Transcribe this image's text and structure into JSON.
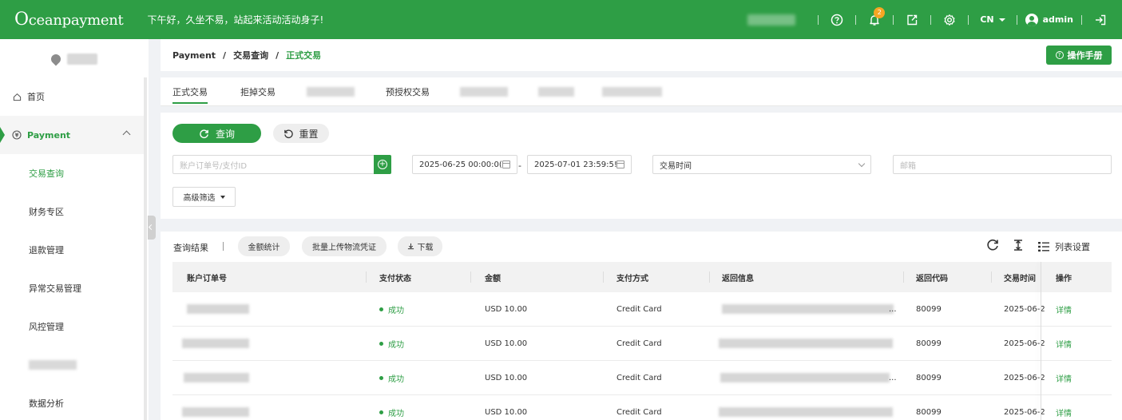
{
  "topbar": {
    "logo_first": "O",
    "logo_rest": "ceanpayment",
    "greeting": "下午好，久坐不易，站起来活动活动身子!",
    "notification_count": "2",
    "language": "CN",
    "username": "admin"
  },
  "sidebar": {
    "items": [
      {
        "label": "首页",
        "icon": "home-icon"
      },
      {
        "label": "Payment",
        "icon": "payment-icon"
      },
      {
        "label": "交易查询"
      },
      {
        "label": "财务专区"
      },
      {
        "label": "退款管理"
      },
      {
        "label": "异常交易管理"
      },
      {
        "label": "风控管理"
      },
      {
        "label": "数据分析"
      }
    ]
  },
  "breadcrumb": {
    "items": [
      "Payment",
      "交易查询",
      "正式交易"
    ],
    "separator": "/"
  },
  "header": {
    "manual_label": "操作手册"
  },
  "tabs": [
    "正式交易",
    "拒掉交易",
    "预授权交易"
  ],
  "filters": {
    "query_label": "查询",
    "reset_label": "重置",
    "order_placeholder": "账户订单号/支付ID",
    "start_date": "2025-06-25 00:00:0(",
    "end_date": "2025-07-01 23:59:5!",
    "date_separator": "-",
    "time_type": "交易时间",
    "email_placeholder": "邮箱",
    "advanced_label": "高级筛选"
  },
  "results": {
    "title": "查询结果",
    "separator": "|",
    "amount_stats_label": "金额统计",
    "batch_upload_label": "批量上传物流凭证",
    "download_label": "下载",
    "list_settings_label": "列表设置",
    "columns": [
      "账户订单号",
      "支付状态",
      "金额",
      "支付方式",
      "返回信息",
      "返回代码",
      "交易时间",
      "操作"
    ],
    "rows": [
      {
        "status": "成功",
        "amount": "USD 10.00",
        "method": "Credit Card",
        "info": "...",
        "code": "80099",
        "time": "2025-06-2",
        "action": "详情"
      },
      {
        "status": "成功",
        "amount": "USD 10.00",
        "method": "Credit Card",
        "info": "",
        "code": "80099",
        "time": "2025-06-2",
        "action": "详情"
      },
      {
        "status": "成功",
        "amount": "USD 10.00",
        "method": "Credit Card",
        "info": "...",
        "code": "80099",
        "time": "2025-06-2",
        "action": "详情"
      },
      {
        "status": "成功",
        "amount": "USD 10.00",
        "method": "Credit Card",
        "info": "",
        "code": "80099",
        "time": "2025-06-2",
        "action": "详情"
      }
    ]
  },
  "colors": {
    "brand": "#2e9e45",
    "badge": "#f5a623"
  }
}
